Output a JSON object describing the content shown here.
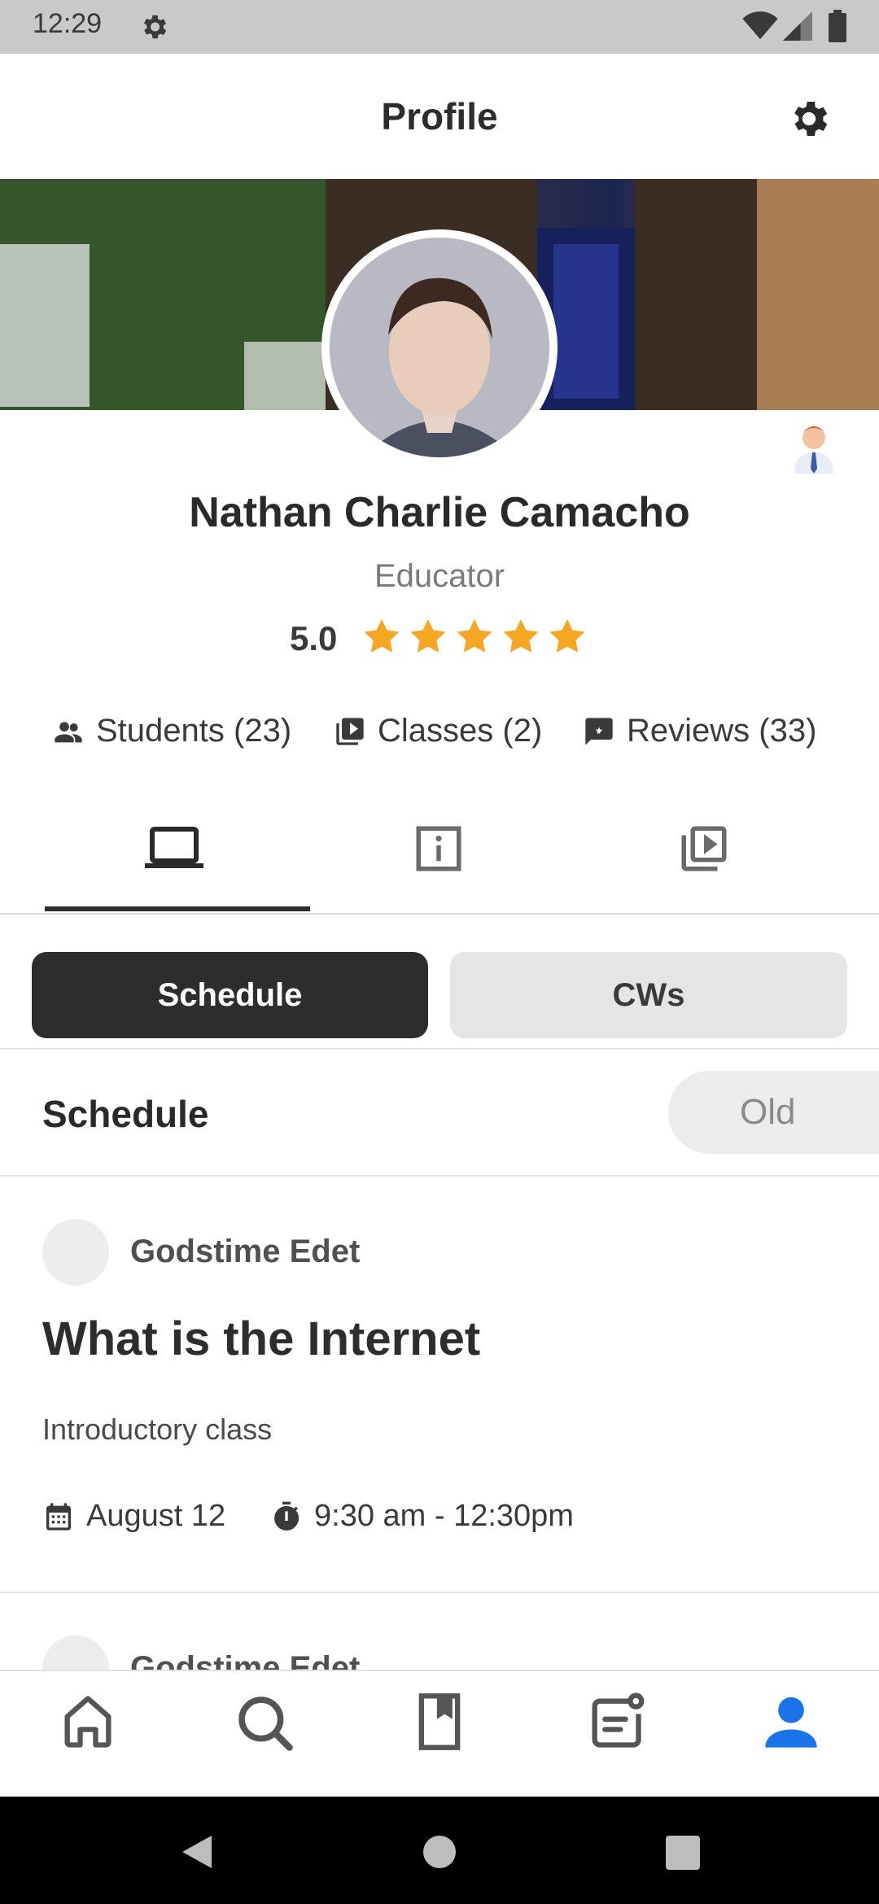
{
  "status_bar": {
    "time": "12:29"
  },
  "app_bar": {
    "title": "Profile"
  },
  "profile": {
    "name": "Nathan Charlie Camacho",
    "role": "Educator",
    "rating": "5.0",
    "rating_stars": 5,
    "stats": {
      "students": "Students (23)",
      "classes": "Classes (2)",
      "reviews": "Reviews (33)"
    }
  },
  "tabs": [
    {
      "icon": "laptop-icon",
      "active": true
    },
    {
      "icon": "info-icon",
      "active": false
    },
    {
      "icon": "video-library-icon",
      "active": false
    }
  ],
  "segments": {
    "active": "Schedule",
    "inactive": "CWs"
  },
  "schedule": {
    "title": "Schedule",
    "filter": "Old",
    "items": [
      {
        "author": "Godstime Edet",
        "title": "What is the Internet",
        "subtitle": "Introductory class",
        "date": "August 12",
        "time": "9:30 am - 12:30pm"
      },
      {
        "author": "Godstime Edet"
      }
    ]
  },
  "bottom_nav": [
    "home-icon",
    "search-icon",
    "bookmark-icon",
    "notes-icon",
    "profile-icon"
  ],
  "colors": {
    "accent": "#1a73e8",
    "star": "#f5a623",
    "dark": "#2d2d2d"
  }
}
